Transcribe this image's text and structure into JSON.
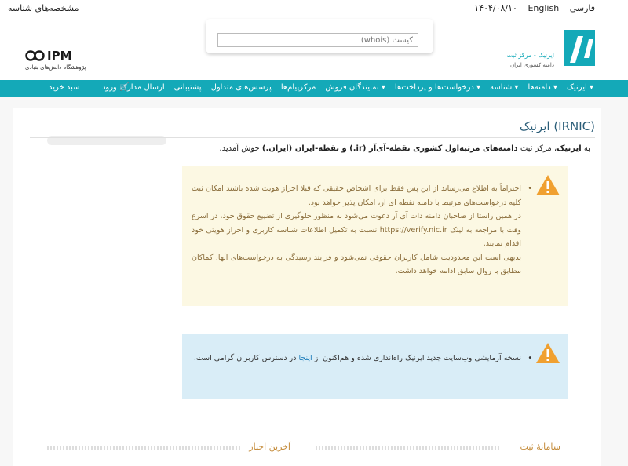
{
  "topbar": {
    "date": "۱۴۰۴/۰۸/۱۰",
    "lang_en": "English",
    "lang_fa": "فارسی",
    "handle_link": "مشخصه‌های شناسه"
  },
  "header": {
    "whois_placeholder": "کیست (whois)",
    "ipm_mark": "IPM",
    "ipm_sub": "پژوهشگاه دانش‌های بنیادی",
    "irnic_name": "ایرنیک - مرکز ثبت",
    "irnic_sub": "دامنه کشوری ایران"
  },
  "nav": {
    "items": [
      "ایرنیک ▾",
      "دامنه‌ها ▾",
      "شناسه ▾",
      "درخواست‌ها و پرداخت‌ها ▾",
      "نمایندگان فروش ▾",
      "مرکزپیام‌ها",
      "پرسش‌های متداول",
      "پشتیبانی",
      "ارسال مدارک"
    ],
    "cart": "سبد خرید",
    "login": "ورود"
  },
  "main": {
    "title": "ایرنیک (IRNIC)",
    "welcome_pre": "به ",
    "welcome_bold1": "ایرنیک",
    "welcome_mid": "، مرکز ثبت ",
    "welcome_bold2": "دامنه‌های مرتبه‌اول کشوری نقطه-آی‌آر (ir.) و نقطه-ایران (ایران.)",
    "welcome_post": " خوش آمدید."
  },
  "alert1": {
    "p1": "احتراماً به اطلاع می‌رساند از این پس فقط برای اشخاص حقیقی که قبلا احراز هویت شده باشند امکان ثبت کلیه درخواست‌های مرتبط با دامنه نقطه آی آر، امکان پذیر خواهد بود.",
    "p2": "در همین راستا از صاحبان دامنه دات آی آر دعوت می‌شود به منظور جلوگیری از تضییع حقوق خود، در اسرع وقت با مراجعه به لینک https://verify.nic.ir نسبت به تکمیل اطلاعات شناسه کاربری و احراز هویتی خود اقدام نمایند.",
    "p3": "بدیهی است این محدودیت شامل کاربران حقوقی نمی‌شود و فرایند رسیدگی به درخواست‌های آنها، کماکان مطابق با روال سابق ادامه خواهد داشت."
  },
  "alert2": {
    "pre": "نسخه آزمایشی وب‌سایت جدید ایرنیک راه‌اندازی شده و هم‌اکنون از ",
    "link": "اینجا",
    "post": " در دسترس کاربران گرامی است."
  },
  "sections": {
    "register": "سامانهٔ ثبت",
    "news": "آخرین اخبار"
  },
  "colors": {
    "nav": "#14a9b8",
    "alert_warning": "#fcf8e3",
    "alert_info": "#d9edf7",
    "warn_icon": "#f0a030"
  }
}
